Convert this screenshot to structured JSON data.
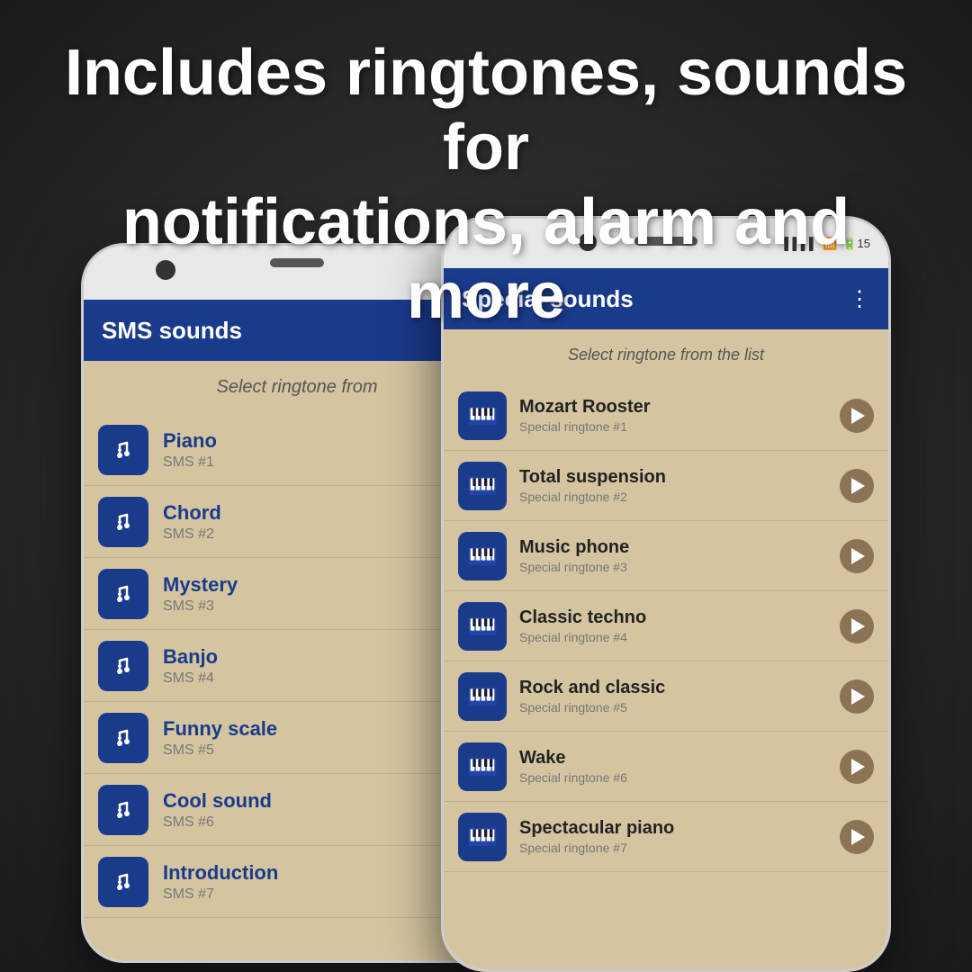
{
  "header": {
    "line1": "Includes ringtones, sounds for",
    "line2": "notifications, alarm and more"
  },
  "left_phone": {
    "app_bar_title": "SMS sounds",
    "subtitle": "Select ringtone from",
    "items": [
      {
        "name": "Piano",
        "sub": "SMS #1"
      },
      {
        "name": "Chord",
        "sub": "SMS #2"
      },
      {
        "name": "Mystery",
        "sub": "SMS #3"
      },
      {
        "name": "Banjo",
        "sub": "SMS #4"
      },
      {
        "name": "Funny scale",
        "sub": "SMS #5"
      },
      {
        "name": "Cool sound",
        "sub": "SMS #6"
      },
      {
        "name": "Introduction",
        "sub": "SMS #7"
      }
    ]
  },
  "right_phone": {
    "app_bar_title": "Special sounds",
    "subtitle": "Select ringtone from the list",
    "menu_icon": "⋮",
    "items": [
      {
        "name": "Mozart Rooster",
        "sub": "Special ringtone #1"
      },
      {
        "name": "Total suspension",
        "sub": "Special ringtone #2"
      },
      {
        "name": "Music phone",
        "sub": "Special ringtone #3"
      },
      {
        "name": "Classic techno",
        "sub": "Special ringtone #4"
      },
      {
        "name": "Rock and classic",
        "sub": "Special ringtone #5"
      },
      {
        "name": "Wake",
        "sub": "Special ringtone #6"
      },
      {
        "name": "Spectacular piano",
        "sub": "Special ringtone #7"
      }
    ],
    "status": {
      "signal": "▌▌▌▌",
      "wifi": "wifi",
      "battery": "15"
    }
  }
}
